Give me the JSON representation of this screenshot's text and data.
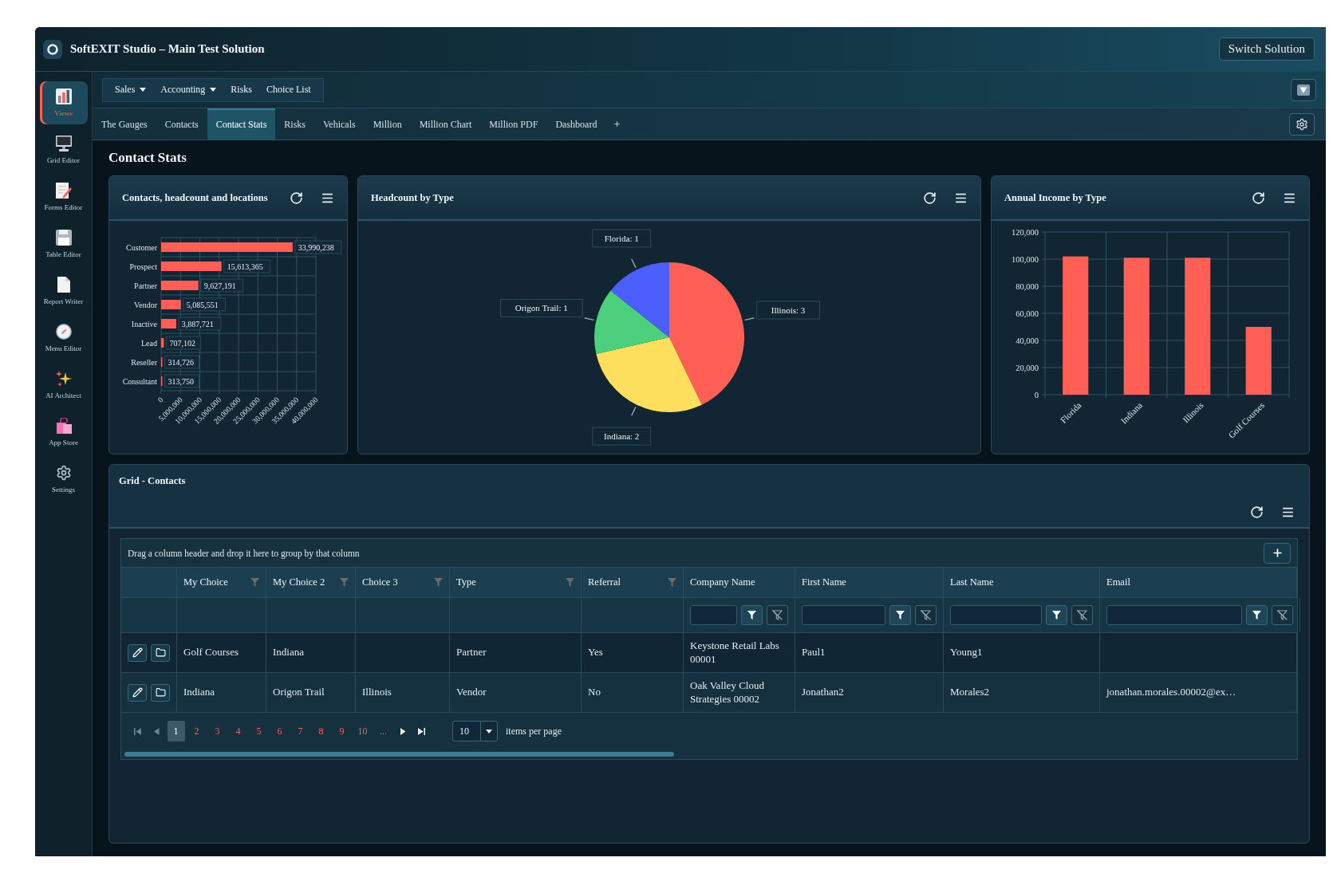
{
  "window": {
    "title": "SoftEXIT Studio – Main Test Solution"
  },
  "header_button": "Switch Solution",
  "sidebar": {
    "items": [
      {
        "label": "Views",
        "selected": true
      },
      {
        "label": "Grid Editor",
        "selected": false
      },
      {
        "label": "Forms Editor",
        "selected": false
      },
      {
        "label": "Table Editor",
        "selected": false
      },
      {
        "label": "Report Writer",
        "selected": false
      },
      {
        "label": "Menu Editor",
        "selected": false
      },
      {
        "label": "AI Architect",
        "selected": false
      },
      {
        "label": "App Store",
        "selected": false
      },
      {
        "label": "Settings",
        "selected": false
      }
    ]
  },
  "menu_bar": {
    "items": [
      {
        "label": "Sales",
        "dropdown": true
      },
      {
        "label": "Accounting",
        "dropdown": true
      },
      {
        "label": "Risks",
        "dropdown": false
      },
      {
        "label": "Choice List",
        "dropdown": false
      }
    ]
  },
  "tabs": {
    "items": [
      {
        "label": "The Gauges",
        "selected": false
      },
      {
        "label": "Contacts",
        "selected": false
      },
      {
        "label": "Contact Stats",
        "selected": true
      },
      {
        "label": "Risks",
        "selected": false
      },
      {
        "label": "Vehicals",
        "selected": false
      },
      {
        "label": "Million",
        "selected": false
      },
      {
        "label": "Million Chart",
        "selected": false
      },
      {
        "label": "Million PDF",
        "selected": false
      },
      {
        "label": "Dashboard",
        "selected": false
      }
    ],
    "add_label": "+"
  },
  "page": {
    "title": "Contact Stats"
  },
  "charts": [
    {
      "title": "Contacts, headcount and locations",
      "chart_data": {
        "type": "bar",
        "orientation": "horizontal",
        "categories": [
          "Customer",
          "Prospect",
          "Partner",
          "Vendor",
          "Inactive",
          "Lead",
          "Reseller",
          "Consultant"
        ],
        "values": [
          33990238,
          15613365,
          9627191,
          5085551,
          3887721,
          707102,
          314726,
          313750
        ],
        "xlim": [
          0,
          40000000
        ],
        "xticks": [
          {
            "value": 0,
            "label": "0"
          },
          {
            "value": 5000000,
            "label": "5,000,000"
          },
          {
            "value": 10000000,
            "label": "10,000,000"
          },
          {
            "value": 15000000,
            "label": "15,000,000"
          },
          {
            "value": 20000000,
            "label": "20,000,000"
          },
          {
            "value": 25000000,
            "label": "25,000,000"
          },
          {
            "value": 30000000,
            "label": "30,000,000"
          },
          {
            "value": 35000000,
            "label": "35,000,000"
          },
          {
            "value": 40000000,
            "label": "40,000,000"
          }
        ],
        "grid": true,
        "value_labels": [
          "33,990,238",
          "15,613,365",
          "9,627,191",
          "5,085,551",
          "3,887,721",
          "707,102",
          "314,726",
          "313,750"
        ]
      }
    },
    {
      "title": "Headcount by Type",
      "chart_data": {
        "type": "pie",
        "values": [
          3,
          2,
          1,
          1
        ],
        "colors": [
          "#ff5f55",
          "#ffdf5d",
          "#4cd07d",
          "#4c5ffd"
        ],
        "value_labels": [
          "Illinois: 3",
          "Indiana: 2",
          "Origon Trail: 1",
          "Florida: 1"
        ]
      }
    },
    {
      "title": "Annual Income by Type",
      "chart_data": {
        "type": "bar",
        "orientation": "vertical",
        "categories": [
          "Florida",
          "Indiana",
          "Illinois",
          "Golf Courses"
        ],
        "values": [
          102000,
          101000,
          101000,
          50000
        ],
        "ylim": [
          0,
          120000
        ],
        "yticks": [
          {
            "value": 0,
            "label": "0"
          },
          {
            "value": 20000,
            "label": "20,000"
          },
          {
            "value": 40000,
            "label": "40,000"
          },
          {
            "value": 60000,
            "label": "60,000"
          },
          {
            "value": 80000,
            "label": "80,000"
          },
          {
            "value": 100000,
            "label": "100,000"
          },
          {
            "value": 120000,
            "label": "120,000"
          }
        ],
        "grid": true
      }
    }
  ],
  "grid": {
    "title": "Grid - Contacts",
    "group_panel": "Drag a column header and drop it here to group by that column",
    "columns": [
      {
        "label": "My Choice",
        "kind": "header_filter"
      },
      {
        "label": "My Choice 2",
        "kind": "header_filter"
      },
      {
        "label": "Choice 3",
        "kind": "header_filter"
      },
      {
        "label": "Type",
        "kind": "header_filter"
      },
      {
        "label": "Referral",
        "kind": "header_filter"
      },
      {
        "label": "Company Name",
        "kind": "row_filter"
      },
      {
        "label": "First Name",
        "kind": "row_filter"
      },
      {
        "label": "Last Name",
        "kind": "row_filter"
      },
      {
        "label": "Email",
        "kind": "row_filter"
      }
    ],
    "rows": [
      {
        "cells": [
          "Golf Courses",
          "Indiana",
          null,
          "Partner",
          "Yes",
          "Keystone Retail Labs 00001",
          "Paul1",
          "Young1",
          null
        ]
      },
      {
        "cells": [
          "Indiana",
          "Origon Trail",
          "Illinois",
          "Vendor",
          "No",
          "Oak Valley Cloud Strategies 00002",
          "Jonathan2",
          "Morales2",
          "jonathan.morales.00002@ex…"
        ]
      }
    ],
    "pager": {
      "first": {
        "disabled": true
      },
      "previous": {
        "disabled": true
      },
      "pages": [
        {
          "label": "1",
          "selected": true
        },
        {
          "label": "2",
          "selected": false
        },
        {
          "label": "3",
          "selected": false
        },
        {
          "label": "4",
          "selected": false
        },
        {
          "label": "5",
          "selected": false
        },
        {
          "label": "6",
          "selected": false
        },
        {
          "label": "7",
          "selected": false
        },
        {
          "label": "8",
          "selected": false
        },
        {
          "label": "9",
          "selected": false
        },
        {
          "label": "10",
          "selected": false
        }
      ],
      "more": "...",
      "next": {
        "disabled": false
      },
      "last": {
        "disabled": false
      },
      "page_size": "10",
      "page_size_label": "items per page"
    }
  }
}
